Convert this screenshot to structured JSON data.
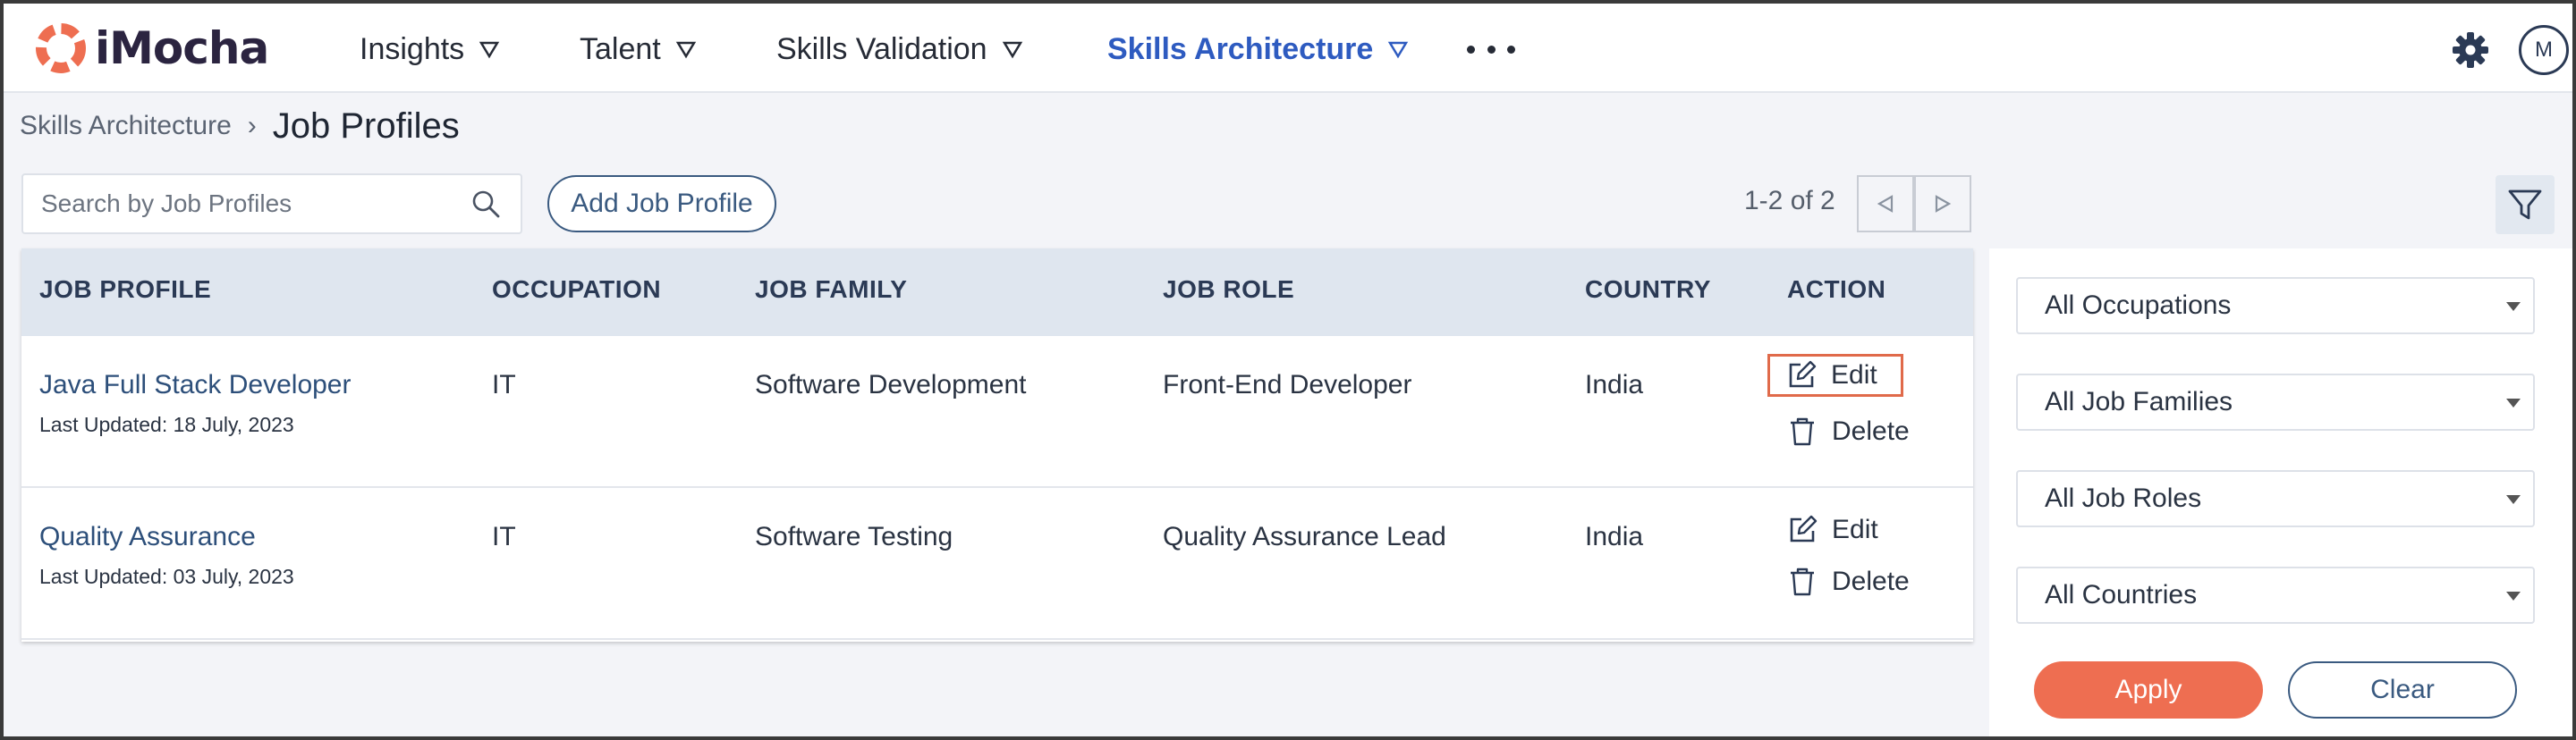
{
  "app": {
    "logo_text": "iMocha",
    "brand_color": "#ee6e51",
    "accent_color": "#2e5bc0"
  },
  "nav": {
    "items": [
      {
        "label": "Insights"
      },
      {
        "label": "Talent"
      },
      {
        "label": "Skills Validation"
      },
      {
        "label": "Skills Architecture",
        "active": true
      }
    ],
    "more_icon": "ellipsis-icon",
    "settings_icon": "gear-icon",
    "avatar_initial": "M"
  },
  "breadcrumb": {
    "parent": "Skills Architecture",
    "separator": "›",
    "current": "Job Profiles"
  },
  "toolbar": {
    "search_placeholder": "Search by Job Profiles",
    "search_value": "",
    "add_button": "Add Job Profile",
    "pagination": "1-2 of 2"
  },
  "table": {
    "columns": [
      "JOB PROFILE",
      "OCCUPATION",
      "JOB FAMILY",
      "JOB ROLE",
      "COUNTRY",
      "ACTION"
    ],
    "rows": [
      {
        "job_profile": "Java Full Stack Developer",
        "updated": "Last Updated: 18 July, 2023",
        "occupation": "IT",
        "job_family": "Software Development",
        "job_role": "Front-End Developer",
        "country": "India",
        "edit": "Edit",
        "delete": "Delete"
      },
      {
        "job_profile": "Quality Assurance",
        "updated": "Last Updated: 03 July, 2023",
        "occupation": "IT",
        "job_family": "Software Testing",
        "job_role": "Quality Assurance Lead",
        "country": "India",
        "edit": "Edit",
        "delete": "Delete"
      }
    ]
  },
  "filters": {
    "occupation": "All Occupations",
    "job_family": "All Job Families",
    "job_role": "All Job Roles",
    "country": "All Countries",
    "apply": "Apply",
    "clear": "Clear"
  }
}
